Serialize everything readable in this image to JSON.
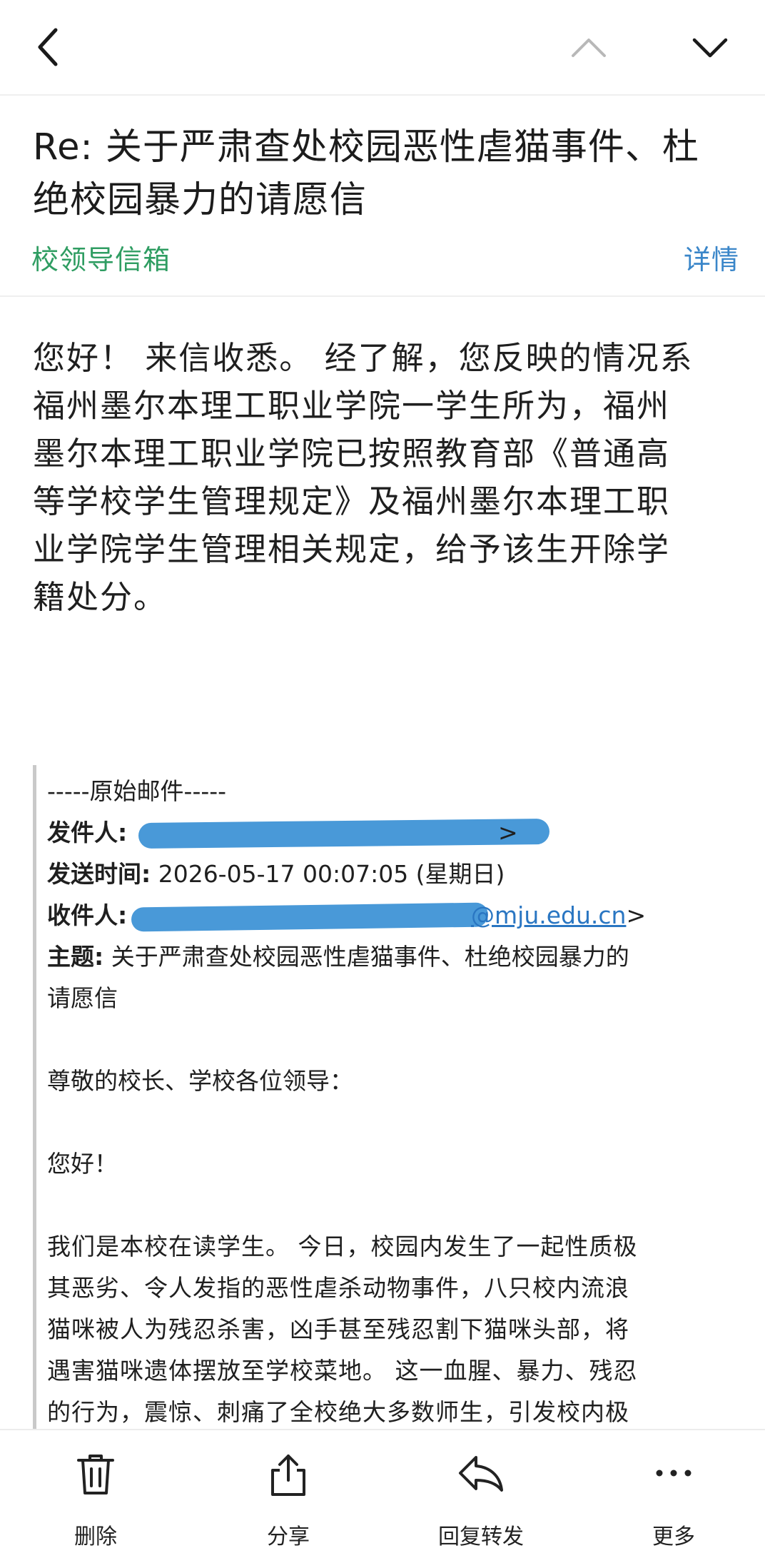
{
  "nav": {
    "back_icon": "chevron-left-icon",
    "prev_icon": "chevron-up-icon",
    "next_icon": "chevron-down-icon"
  },
  "email": {
    "subject_line1": "Re: 关于严肃查处校园恶性虐猫事件、杜",
    "subject_line2": "绝校园暴力的请愿信",
    "sender": "校领导信箱",
    "details_link": "详情",
    "reply_lines": [
      "您好！ 来信收悉。 经了解，您反映的情况系",
      "福州墨尔本理工职业学院一学生所为，福州",
      "墨尔本理工职业学院已按照教育部《普通高",
      "等学校学生管理规定》及福州墨尔本理工职",
      "业学院学生管理相关规定，给予该生开除学",
      "籍处分。"
    ]
  },
  "original": {
    "separator": "-----原始邮件-----",
    "from_label": "发件人:",
    "from_tail": ">",
    "sent_label": "发送时间:",
    "sent_value": "2026-05-17 00:07:05 (星期日)",
    "to_label": "收件人:",
    "to_domain": "@mju.edu.cn",
    "to_tail": ">",
    "subject_label": "主题:",
    "subject_value": "关于严肃查处校园恶性虐猫事件、杜绝校园暴力的",
    "subject_value_cont": "请愿信",
    "greeting1": "尊敬的校长、学校各位领导：",
    "greeting2": "您好！",
    "body_lines": [
      "我们是本校在读学生。 今日，校园内发生了一起性质极",
      "其恶劣、令人发指的恶性虐杀动物事件，八只校内流浪",
      "猫咪被人为残忍杀害，凶手甚至残忍割下猫咪头部，将",
      "遇害猫咪遗体摆放至学校菜地。 这一血腥、暴力、残忍",
      "的行为，震惊、刺痛了全校绝大多数师生，引发校内极"
    ]
  },
  "toolbar": {
    "items": [
      {
        "label": "删除",
        "icon": "trash-icon"
      },
      {
        "label": "分享",
        "icon": "share-icon"
      },
      {
        "label": "回复转发",
        "icon": "reply-icon"
      },
      {
        "label": "更多",
        "icon": "more-icon"
      }
    ]
  },
  "colors": {
    "sender_green": "#2f9d62",
    "link_blue": "#3a86c9",
    "redaction_blue": "#3f93d6"
  }
}
